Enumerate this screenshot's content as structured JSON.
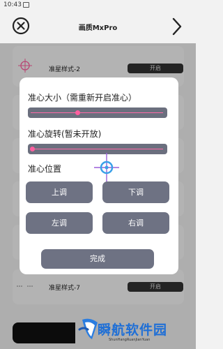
{
  "status_bar": {
    "time": "10:43"
  },
  "header": {
    "title": "画质MxPro"
  },
  "list": {
    "rows": [
      {
        "label": "准星样式-2",
        "button": "开启"
      },
      {
        "label": "准星样式-7",
        "button": "开启"
      }
    ]
  },
  "dialog": {
    "size_label": "准心大小（需重新开启准心）",
    "size_value": 0.34,
    "rotate_label": "准心旋转(暂未开放)",
    "rotate_value": 0.0,
    "position_label": "准心位置",
    "buttons": {
      "up": "上调",
      "down": "下调",
      "left": "左调",
      "right": "右调"
    },
    "done": "完成"
  },
  "watermark": {
    "brand": "瞬航软件园",
    "pinyin": "ShunHangRuanJianYuan"
  },
  "colors": {
    "accent_pink": "#ff5fa0",
    "button_gray": "#6e7283",
    "crosshair_blue": "#3aa0e8",
    "crosshair_purple": "#9a5fd8"
  }
}
